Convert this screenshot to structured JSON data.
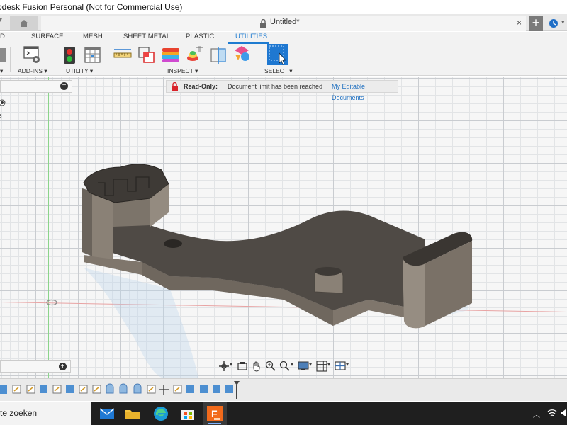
{
  "window": {
    "title": "odesk Fusion Personal (Not for Commercial Use)"
  },
  "tabs": {
    "document_title": "Untitled*",
    "close": "×",
    "new_tab": "+"
  },
  "ribbon": {
    "tabs": [
      "D",
      "SURFACE",
      "MESH",
      "SHEET METAL",
      "PLASTIC",
      "UTILITIES"
    ],
    "active_tab": "UTILITIES",
    "groups": {
      "addins": "ADD-INS ▾",
      "utility": "UTILITY ▾",
      "inspect": "INSPECT ▾",
      "select": "SELECT ▾",
      "left_cut": "▾"
    }
  },
  "banner": {
    "status": "Read-Only:",
    "message": "Document limit has been reached",
    "link": "My Editable Documents"
  },
  "panel": {
    "stub_text": "s"
  },
  "taskbar": {
    "search_text": "te zoeken"
  },
  "colors": {
    "accent": "#1e7bd0",
    "model_body": "#7a7167",
    "model_top": "#5a554f",
    "lock_red": "#d9232a",
    "fusion_orange": "#f26a1b"
  },
  "icons": {
    "ribbon": [
      "addins-icon",
      "traffic-light-icon",
      "table-icon",
      "measure-icon",
      "interference-icon",
      "zebra-icon",
      "curvature-icon",
      "section-icon",
      "display-settings-icon",
      "select-icon"
    ],
    "taskbar": [
      "mail-icon",
      "file-explorer-icon",
      "edge-icon",
      "store-icon",
      "fusion-icon"
    ]
  }
}
